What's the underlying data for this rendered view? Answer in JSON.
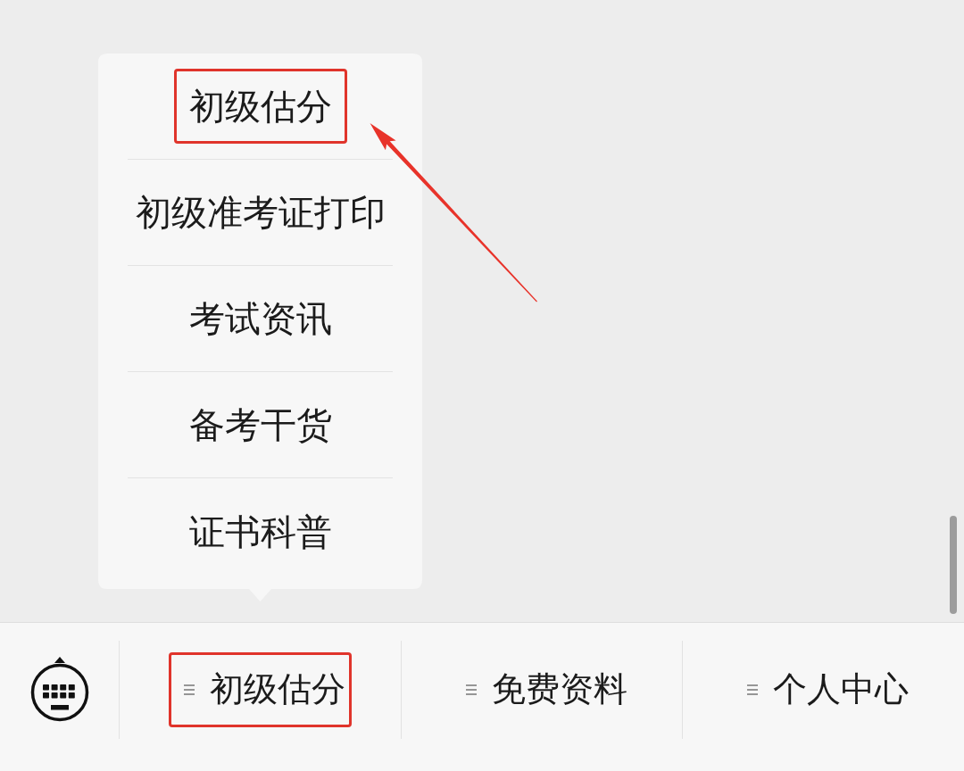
{
  "menu_bar": {
    "items": [
      {
        "label": "初级估分",
        "highlighted": true,
        "submenu": [
          {
            "label": "初级估分",
            "highlighted": true
          },
          {
            "label": "初级准考证打印",
            "highlighted": false
          },
          {
            "label": "考试资讯",
            "highlighted": false
          },
          {
            "label": "备考干货",
            "highlighted": false
          },
          {
            "label": "证书科普",
            "highlighted": false
          }
        ]
      },
      {
        "label": "免费资料",
        "highlighted": false
      },
      {
        "label": "个人中心",
        "highlighted": false
      }
    ]
  }
}
